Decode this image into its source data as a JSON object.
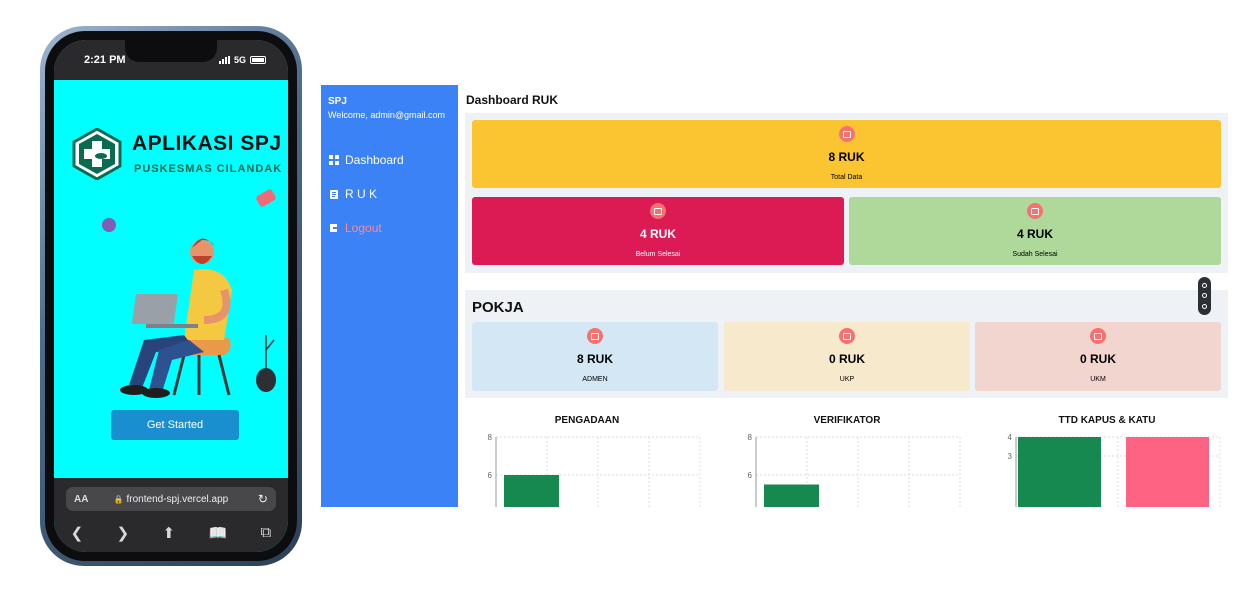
{
  "phone": {
    "status_time": "2:21 PM",
    "network": "5G",
    "app_title": "APLIKASI SPJ",
    "app_subtitle": "PUSKESMAS CILANDAK",
    "cta_label": "Get Started",
    "browser": {
      "aa_label": "AA",
      "url": "frontend-spj.vercel.app"
    },
    "colors": {
      "screen_bg": "#00ffff",
      "cta": "#1a8fd0"
    }
  },
  "sidebar": {
    "brand": "SPJ",
    "welcome": "Welcome, admin@gmail.com",
    "items": [
      {
        "label": "Dashboard",
        "icon": "grid-icon"
      },
      {
        "label": "R U K",
        "icon": "clipboard-icon"
      },
      {
        "label": "Logout",
        "icon": "logout-icon"
      }
    ],
    "color": "#3b82f6"
  },
  "dashboard": {
    "title": "Dashboard RUK",
    "summary": {
      "total": {
        "value": "8 RUK",
        "label": "Total Data",
        "color": "#fbc531"
      },
      "belum": {
        "value": "4 RUK",
        "label": "Belum Selesai",
        "color": "#dc1a54"
      },
      "sudah": {
        "value": "4 RUK",
        "label": "Sudah Selesai",
        "color": "#aed99a"
      }
    },
    "pokja": {
      "title": "POKJA",
      "cards": [
        {
          "value": "8 RUK",
          "label": "ADMEN",
          "color": "#d4e7f5"
        },
        {
          "value": "0 RUK",
          "label": "UKP",
          "color": "#f7e9cb"
        },
        {
          "value": "0 RUK",
          "label": "UKM",
          "color": "#f2d5ce"
        }
      ]
    }
  },
  "chart_data": [
    {
      "type": "bar",
      "title": "PENGADAAN",
      "ylim": [
        4,
        8
      ],
      "y_ticks": [
        "8",
        "6"
      ],
      "values": [
        6
      ],
      "colors": [
        "#15894f"
      ],
      "grid": true
    },
    {
      "type": "bar",
      "title": "VERIFIKATOR",
      "ylim": [
        4,
        8
      ],
      "y_ticks": [
        "8",
        "6"
      ],
      "values": [
        5.5
      ],
      "colors": [
        "#15894f"
      ],
      "grid": true
    },
    {
      "type": "bar",
      "title": "TTD KAPUS & KATU",
      "ylim": [
        2,
        4
      ],
      "y_ticks": [
        "4",
        "3"
      ],
      "values": [
        4,
        4
      ],
      "colors": [
        "#15894f",
        "#ff6384"
      ],
      "grid": true
    }
  ]
}
